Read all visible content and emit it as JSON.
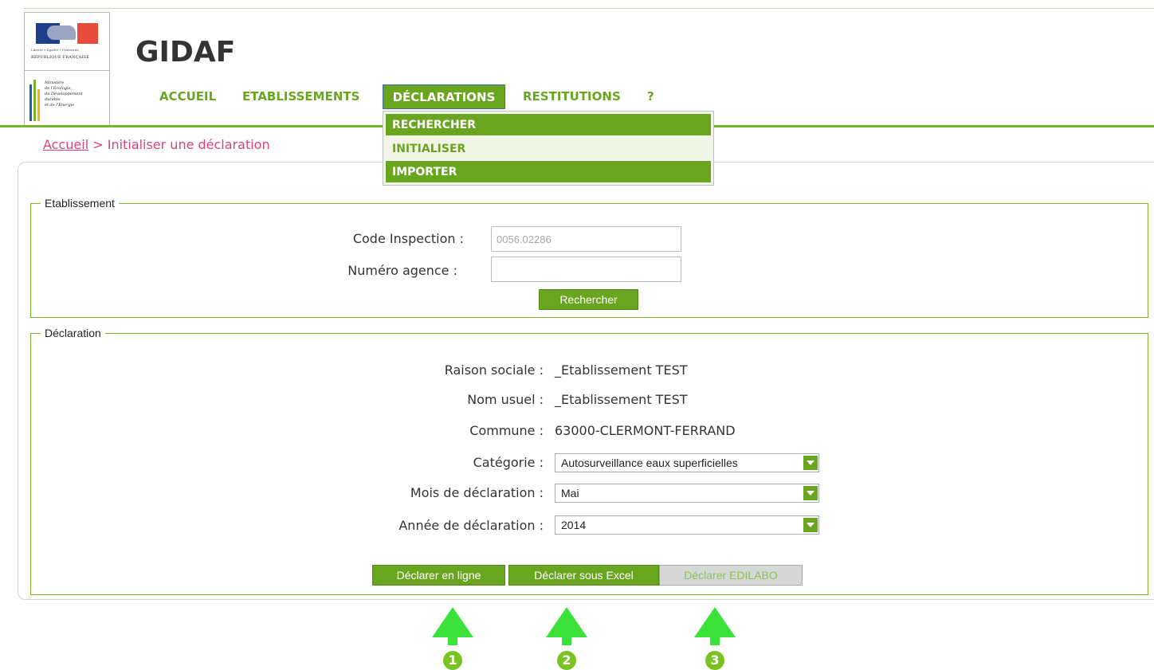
{
  "app": {
    "title": "GIDAF"
  },
  "logo": {
    "rf_motto": "Liberté • Égalité • Fraternité",
    "rf_name": "RÉPUBLIQUE FRANÇAISE",
    "ministry_lines": [
      "Ministère",
      "de l'Écologie,",
      "du Développement",
      "durable",
      "et de l'Énergie"
    ]
  },
  "nav": {
    "items": [
      {
        "label": "ACCUEIL"
      },
      {
        "label": "ETABLISSEMENTS"
      },
      {
        "label": "DÉCLARATIONS",
        "active": true
      },
      {
        "label": "RESTITUTIONS"
      },
      {
        "label": "?"
      }
    ],
    "dropdown": [
      "RECHERCHER",
      "INITIALISER",
      "IMPORTER"
    ]
  },
  "breadcrumb": {
    "home": "Accueil",
    "separator": ">",
    "current": "Initialiser une déclaration"
  },
  "etablissement": {
    "legend": "Etablissement",
    "code_label": "Code Inspection :",
    "code_value": "0056.02286",
    "agence_label": "Numéro agence :",
    "agence_value": "",
    "search_button": "Rechercher"
  },
  "declaration": {
    "legend": "Déclaration",
    "rows": [
      {
        "label": "Raison sociale :",
        "value": "_Etablissement TEST"
      },
      {
        "label": "Nom usuel :",
        "value": "_Etablissement TEST"
      },
      {
        "label": "Commune :",
        "value": "63000-CLERMONT-FERRAND"
      }
    ],
    "categorie_label": "Catégorie :",
    "categorie_value": "Autosurveillance eaux superficielles",
    "mois_label": "Mois de déclaration :",
    "mois_value": "Mai",
    "annee_label": "Année de déclaration :",
    "annee_value": "2014",
    "buttons": [
      "Déclarer en ligne",
      "Déclarer sous Excel",
      "Déclarer EDILABO"
    ]
  },
  "markers": [
    "1",
    "2",
    "3"
  ],
  "colors": {
    "accent": "#6aa51f",
    "arrow": "#3ae23a",
    "breadcrumb": "#d9437e"
  }
}
